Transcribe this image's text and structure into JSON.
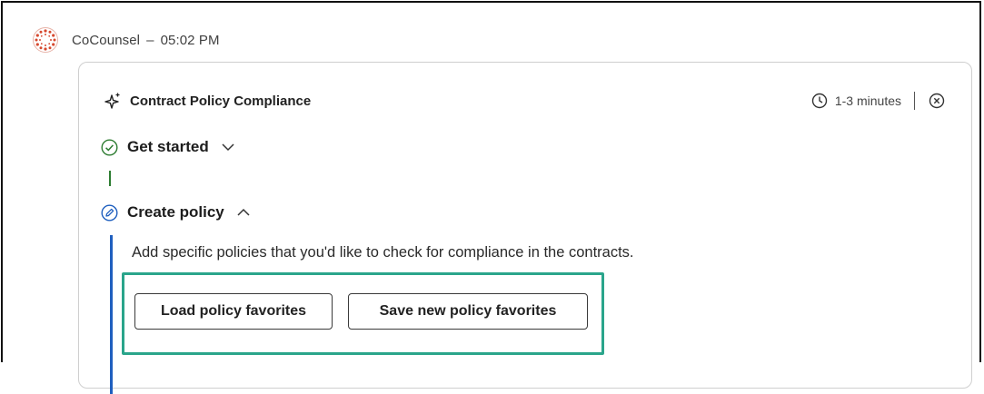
{
  "message": {
    "sender": "CoCounsel",
    "separator": "–",
    "time": "05:02 PM",
    "avatar_icon": "cocounsel-logo-icon",
    "avatar_color": "#d6492f"
  },
  "card": {
    "title": "Contract Policy Compliance",
    "title_icon": "sparkle-icon",
    "duration": "1-3 minutes",
    "duration_icon": "clock-icon",
    "close_icon": "close-circle-icon"
  },
  "steps": [
    {
      "label": "Get started",
      "state": "complete",
      "state_icon": "check-circle-icon",
      "state_color": "#2e7d32",
      "chevron": "chevron-down-icon"
    },
    {
      "label": "Create policy",
      "state": "active",
      "state_icon": "pencil-circle-icon",
      "state_color": "#1f5fbf",
      "chevron": "chevron-up-icon",
      "description": "Add specific policies that you'd like to check for compliance in the contracts.",
      "buttons": {
        "load": "Load policy favorites",
        "save": "Save new policy favorites"
      }
    }
  ],
  "colors": {
    "highlight": "#2aa58b",
    "complete": "#2e7d32",
    "active": "#1f5fbf"
  }
}
